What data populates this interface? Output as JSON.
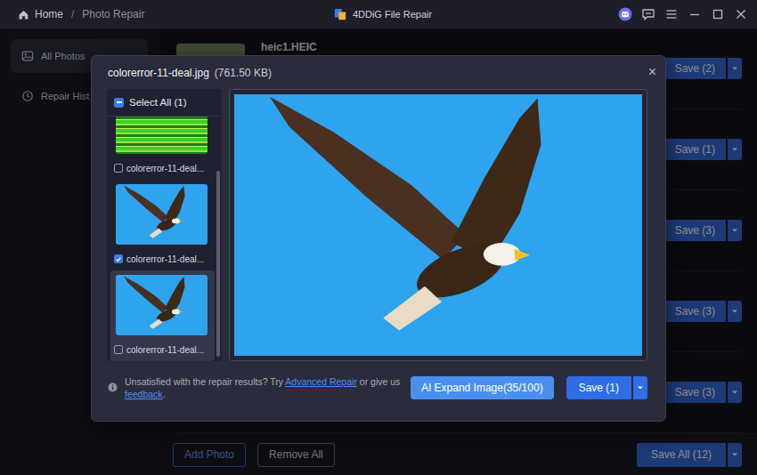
{
  "window": {
    "title": "4DDiG File Repair"
  },
  "breadcrumb": {
    "home": "Home",
    "separator": "/",
    "current": "Photo Repair"
  },
  "sidebar": {
    "items": [
      {
        "label": "All Photos",
        "selected": true
      },
      {
        "label": "Repair Hist",
        "selected": false
      }
    ]
  },
  "rows": [
    {
      "name": "heic1.HEIC",
      "save": "Save (2)"
    },
    {
      "save": "Save (1)"
    },
    {
      "save": "Save (3)"
    },
    {
      "save": "Save (3)"
    },
    {
      "save": "Save (3)"
    }
  ],
  "bottom_bar": {
    "add": "Add Photo",
    "remove": "Remove All",
    "save_all": "Save All (12)"
  },
  "modal": {
    "title": "colorerror-11-deal.jpg",
    "size": "(761.50 KB)",
    "close": "×",
    "select_all": {
      "label": "Select All (1)",
      "indeterminate": true
    },
    "thumbnails": [
      {
        "label": "colorerror-11-deal...",
        "kind": "glitch",
        "checked": false,
        "selected": false
      },
      {
        "label": "colorerror-11-deal...",
        "kind": "photo",
        "checked": true,
        "selected": false
      },
      {
        "label": "colorerror-11-deal...",
        "kind": "photo",
        "checked": false,
        "selected": true
      }
    ],
    "scrollbar": {
      "offset": 0.22,
      "level": 0.76
    },
    "note": {
      "before": "Unsatisfied with the repair results? Try ",
      "link1": "Advanced Repair",
      "middle": " or give us ",
      "link2": "feedback",
      "after": "."
    },
    "ai_button": "AI Expand Image(35/100)",
    "save_button": "Save (1)"
  }
}
